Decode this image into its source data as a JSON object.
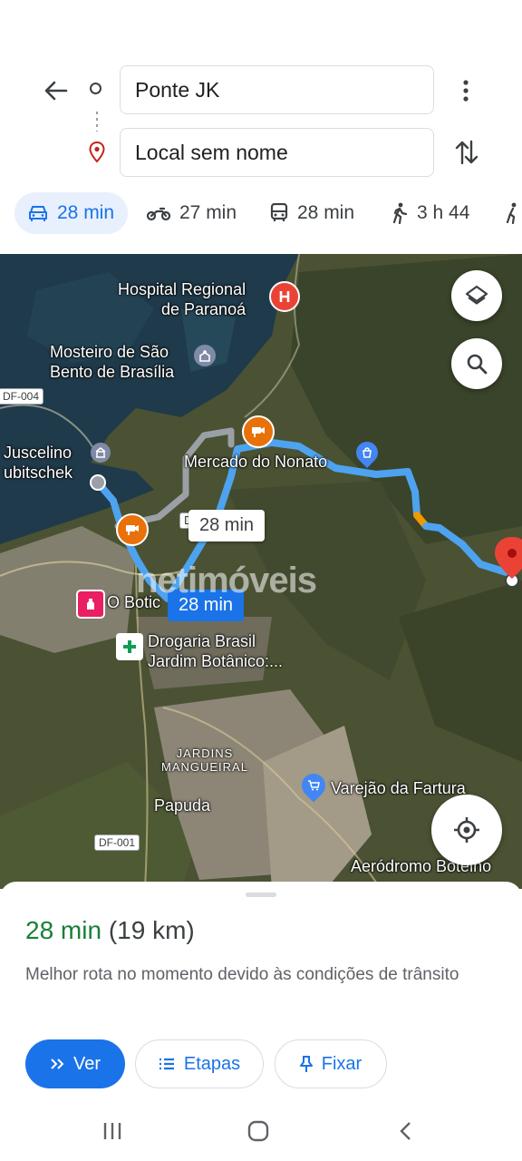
{
  "search": {
    "origin": "Ponte JK",
    "destination": "Local sem nome"
  },
  "modes": [
    {
      "name": "car",
      "time": "28 min",
      "selected": true
    },
    {
      "name": "motorcycle",
      "time": "27 min",
      "selected": false
    },
    {
      "name": "transit",
      "time": "28 min",
      "selected": false
    },
    {
      "name": "walk",
      "time": "3 h 44",
      "selected": false
    }
  ],
  "map": {
    "labels": {
      "hospital": "Hospital Regional\nde Paranoá",
      "monastery": "Mosteiro de São\nBento de Brasília",
      "juscelino": "Juscelino\nubitschek",
      "market": "Mercado do Nonato",
      "boticario": "O Botic",
      "drogaria": "Drogaria Brasil\nJardim Botânico:...",
      "jardins": "JARDINS\nMANGUEIRAL",
      "papuda": "Papuda",
      "varejao": "Varejão da Fartura",
      "aerodromo": "Aeródromo Botelho"
    },
    "road_df004": "DF-004",
    "road_df001": "DF-001",
    "road_d_partial": "D",
    "alt_route_time": "28 min",
    "main_route_time": "28 min",
    "watermark": "netimóveis",
    "colors": {
      "route": "#4ea3f0",
      "route_alt": "#9aa0a6",
      "traffic": "#f29900",
      "dest_pin": "#ea4335"
    }
  },
  "sheet": {
    "time": "28 min",
    "distance": "(19 km)",
    "description": "Melhor rota no momento devido às condições de trânsito",
    "buttons": {
      "view": "Ver",
      "steps": "Etapas",
      "pin": "Fixar"
    }
  }
}
